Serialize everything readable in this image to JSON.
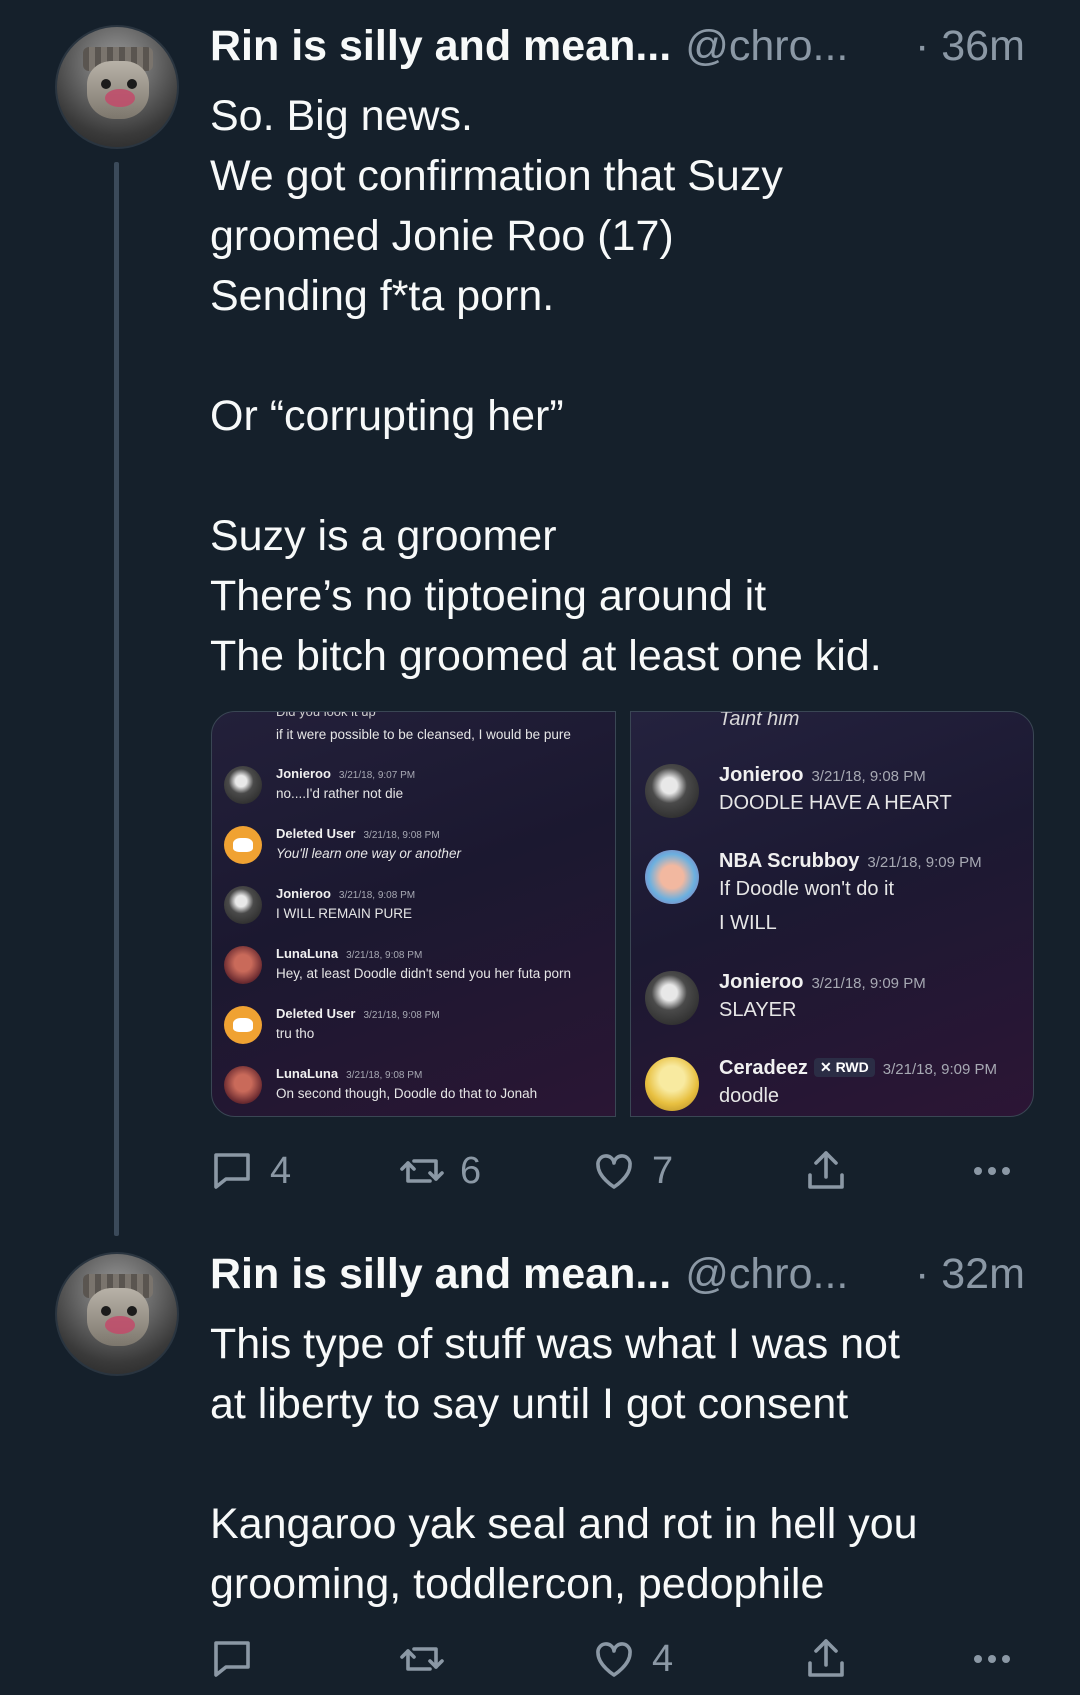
{
  "tweets": [
    {
      "display_name": "Rin is silly and mean...",
      "handle": "@chro...",
      "time": "· 36m",
      "lines": [
        "So. Big news.",
        "We got confirmation that Suzy",
        "groomed Jonie Roo (17)",
        "Sending f*ta porn.",
        "",
        "Or “corrupting her”",
        "",
        "Suzy is a groomer",
        "There’s no tiptoeing around it",
        "The bitch groomed at least one kid."
      ],
      "media_left": {
        "top_cut": "Did you look it up",
        "top_line": "if it were possible to be cleansed, I would be pure",
        "messages": [
          {
            "name": "Jonieroo",
            "time": "3/21/18, 9:07 PM",
            "text": "no....I'd rather not die",
            "avatar": "jonie-avatar"
          },
          {
            "name": "Deleted User",
            "time": "3/21/18, 9:08 PM",
            "text": "You'll learn one way or another",
            "avatar": "deleted-user-avatar"
          },
          {
            "name": "Jonieroo",
            "time": "3/21/18, 9:08 PM",
            "text": "I WILL REMAIN PURE",
            "avatar": "jonie-avatar"
          },
          {
            "name": "LunaLuna",
            "time": "3/21/18, 9:08 PM",
            "text": "Hey, at least Doodle didn't send you her futa porn",
            "avatar": "luna-avatar"
          },
          {
            "name": "Deleted User",
            "time": "3/21/18, 9:08 PM",
            "text": "tru tho",
            "avatar": "deleted-user-avatar"
          },
          {
            "name": "LunaLuna",
            "time": "3/21/18, 9:08 PM",
            "text": "On second though, Doodle do that to Jonah",
            "avatar": "luna-avatar"
          }
        ]
      },
      "media_right": {
        "top_cut": "Taint him",
        "messages": [
          {
            "name": "Jonieroo",
            "time": "3/21/18, 9:08 PM",
            "text": "DOODLE HAVE A HEART",
            "avatar": "jonie-avatar"
          },
          {
            "name": "NBA Scrubboy",
            "time": "3/21/18, 9:09 PM",
            "text": "If Doodle won't do it",
            "text2": "I WILL",
            "avatar": "nba-avatar"
          },
          {
            "name": "Jonieroo",
            "time": "3/21/18, 9:09 PM",
            "text": "SLAYER",
            "avatar": "jonie-avatar"
          },
          {
            "name": "Ceradeez",
            "badge": "RWD",
            "time": "3/21/18, 9:09 PM",
            "text": "doodle",
            "avatar": "ceradeez-avatar"
          }
        ]
      },
      "actions": {
        "replies": "4",
        "retweets": "6",
        "likes": "7"
      }
    },
    {
      "display_name": "Rin is silly and mean...",
      "handle": "@chro...",
      "time": "· 32m",
      "lines": [
        "This type of stuff was what I was not",
        "at liberty to say until I got consent",
        "",
        "Kangaroo yak seal and rot in hell you",
        "grooming, toddlercon, pedophile"
      ],
      "actions": {
        "replies": "",
        "retweets": "",
        "likes": "4"
      }
    }
  ],
  "colors": {
    "background": "#15202b",
    "text": "#f7f9f9",
    "secondary": "#8b98a5",
    "thread_line": "#3b4a5a"
  },
  "icons": [
    "reply-icon",
    "retweet-icon",
    "like-icon",
    "share-icon",
    "more-icon"
  ]
}
